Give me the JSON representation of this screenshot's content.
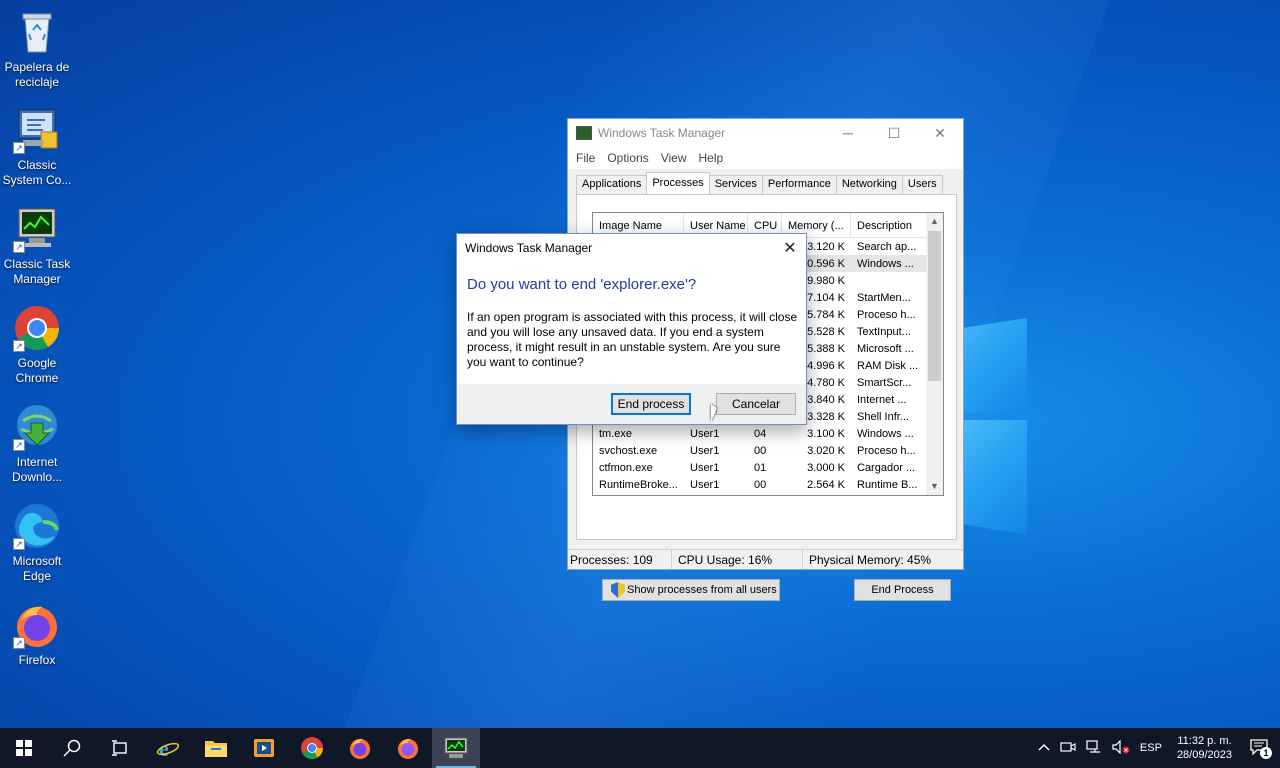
{
  "desktop": {
    "icons": [
      {
        "label": "Papelera de reciclaje",
        "icon": "recycle-bin"
      },
      {
        "label": "Classic System Co...",
        "icon": "control-panel"
      },
      {
        "label": "Classic Task Manager",
        "icon": "task-manager"
      },
      {
        "label": "Google Chrome",
        "icon": "chrome"
      },
      {
        "label": "Internet Downlo...",
        "icon": "idm"
      },
      {
        "label": "Microsoft Edge",
        "icon": "edge"
      },
      {
        "label": "Firefox",
        "icon": "firefox"
      }
    ]
  },
  "task_manager": {
    "title": "Windows Task Manager",
    "menu": [
      "File",
      "Options",
      "View",
      "Help"
    ],
    "tabs": [
      "Applications",
      "Processes",
      "Services",
      "Performance",
      "Networking",
      "Users"
    ],
    "active_tab": "Processes",
    "columns": [
      "Image Name",
      "User Name",
      "CPU",
      "Memory (...",
      "Description"
    ],
    "rows": [
      {
        "image": "",
        "user": "",
        "cpu": "",
        "mem": "3.120 K",
        "desc": "Search ap..."
      },
      {
        "image": "",
        "user": "",
        "cpu": "",
        "mem": "0.596 K",
        "desc": "Windows ..."
      },
      {
        "image": "",
        "user": "",
        "cpu": "",
        "mem": "9.980 K",
        "desc": ""
      },
      {
        "image": "",
        "user": "",
        "cpu": "",
        "mem": "7.104 K",
        "desc": "StartMen..."
      },
      {
        "image": "",
        "user": "",
        "cpu": "",
        "mem": "5.784 K",
        "desc": "Proceso h..."
      },
      {
        "image": "",
        "user": "",
        "cpu": "",
        "mem": "5.528 K",
        "desc": "TextInput..."
      },
      {
        "image": "",
        "user": "",
        "cpu": "",
        "mem": "5.388 K",
        "desc": "Microsoft ..."
      },
      {
        "image": "",
        "user": "",
        "cpu": "",
        "mem": "4.996 K",
        "desc": "RAM Disk ..."
      },
      {
        "image": "",
        "user": "",
        "cpu": "",
        "mem": "4.780 K",
        "desc": "SmartScr..."
      },
      {
        "image": "",
        "user": "",
        "cpu": "",
        "mem": "3.840 K",
        "desc": "Internet ..."
      },
      {
        "image": "",
        "user": "",
        "cpu": "",
        "mem": "3.328 K",
        "desc": "Shell Infr..."
      },
      {
        "image": "tm.exe",
        "user": "User1",
        "cpu": "04",
        "mem": "3.100 K",
        "desc": "Windows ..."
      },
      {
        "image": "svchost.exe",
        "user": "User1",
        "cpu": "00",
        "mem": "3.020 K",
        "desc": "Proceso h..."
      },
      {
        "image": "ctfmon.exe",
        "user": "User1",
        "cpu": "01",
        "mem": "3.000 K",
        "desc": "Cargador ..."
      },
      {
        "image": "RuntimeBroke...",
        "user": "User1",
        "cpu": "00",
        "mem": "2.564 K",
        "desc": "Runtime B..."
      }
    ],
    "show_all_label": "Show processes from all users",
    "end_process_label": "End Process",
    "status": {
      "processes": "Processes: 109",
      "cpu": "CPU Usage: 16%",
      "memory": "Physical Memory: 45%"
    }
  },
  "dialog": {
    "title": "Windows Task Manager",
    "heading": "Do you want to end 'explorer.exe'?",
    "body": "If an open program is associated with this process, it will close and you will lose any unsaved data. If you end a system process, it might result in an unstable system. Are you sure you want to continue?",
    "confirm_label": "End process",
    "cancel_label": "Cancelar"
  },
  "taskbar": {
    "language": "ESP",
    "time": "11:32 p. m.",
    "date": "28/09/2023",
    "notification_count": "1"
  }
}
